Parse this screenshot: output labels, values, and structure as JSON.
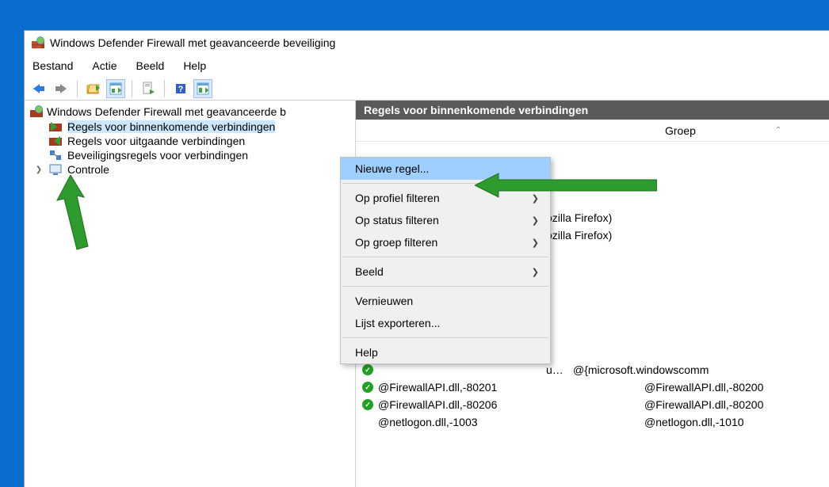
{
  "window": {
    "title": "Windows Defender Firewall met geavanceerde beveiliging"
  },
  "menu": {
    "bestand": "Bestand",
    "actie": "Actie",
    "beeld": "Beeld",
    "help": "Help"
  },
  "tree": {
    "root": "Windows Defender Firewall met geavanceerde b",
    "inbound": "Regels voor binnenkomende verbindingen",
    "outbound": "Regels voor uitgaande verbindingen",
    "connsec": "Beveiligingsregels voor verbindingen",
    "controle": "Controle"
  },
  "header": {
    "pane_title": "Regels voor binnenkomende verbindingen",
    "col_group": "Groep"
  },
  "context_menu": {
    "new_rule": "Nieuwe regel...",
    "filter_profile": "Op profiel filteren",
    "filter_status": "Op status filteren",
    "filter_group": "Op groep filteren",
    "view": "Beeld",
    "refresh": "Vernieuwen",
    "export": "Lijst exporteren...",
    "help": "Help"
  },
  "rows": [
    {
      "name_suffix": "ozilla Firefox)",
      "group": ""
    },
    {
      "name_suffix": "ozilla Firefox)",
      "group": ""
    },
    {
      "name": "unicationsapp...",
      "group": "@{microsoft.windowscomm"
    },
    {
      "name": "@FirewallAPI.dll,-80201",
      "group": "@FirewallAPI.dll,-80200"
    },
    {
      "name": "@FirewallAPI.dll,-80206",
      "group": "@FirewallAPI.dll,-80200"
    },
    {
      "name": "@netlogon.dll,-1003",
      "group": "@netlogon.dll,-1010"
    }
  ]
}
